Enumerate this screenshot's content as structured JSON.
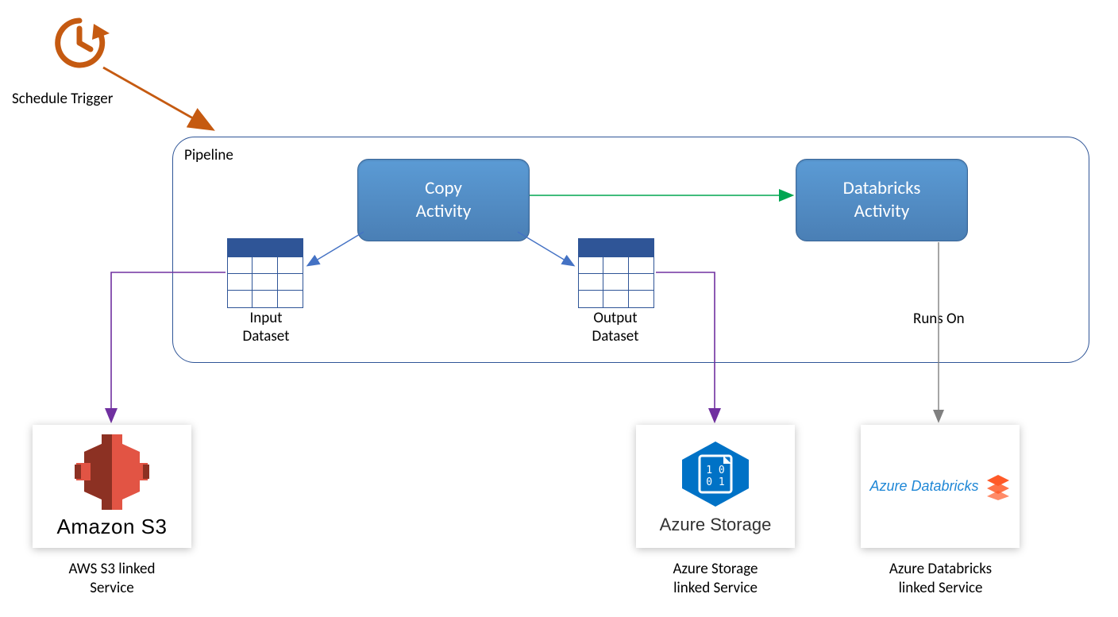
{
  "trigger": {
    "label": "Schedule Trigger"
  },
  "pipeline": {
    "label": "Pipeline",
    "activities": {
      "copy": {
        "line1": "Copy",
        "line2": "Activity"
      },
      "databricks": {
        "line1": "Databricks",
        "line2": "Activity"
      }
    },
    "datasets": {
      "input": {
        "line1": "Input",
        "line2": "Dataset"
      },
      "output": {
        "line1": "Output",
        "line2": "Dataset"
      }
    },
    "runs_on_label": "Runs On"
  },
  "services": {
    "s3": {
      "icon_text": "Amazon S3",
      "caption_l1": "AWS S3 linked",
      "caption_l2": "Service"
    },
    "azure_storage": {
      "icon_text": "Azure Storage",
      "caption_l1": "Azure Storage",
      "caption_l2": "linked Service",
      "hex_digits_top": "1 0",
      "hex_digits_bottom": "0 1"
    },
    "azure_db": {
      "icon_text": "Azure Databricks",
      "caption_l1": "Azure Databricks",
      "caption_l2": "linked Service"
    }
  },
  "colors": {
    "blue": "#2f5597",
    "green": "#00a651",
    "purple": "#7030a0",
    "orange": "#c55a11",
    "gray": "#808080"
  }
}
